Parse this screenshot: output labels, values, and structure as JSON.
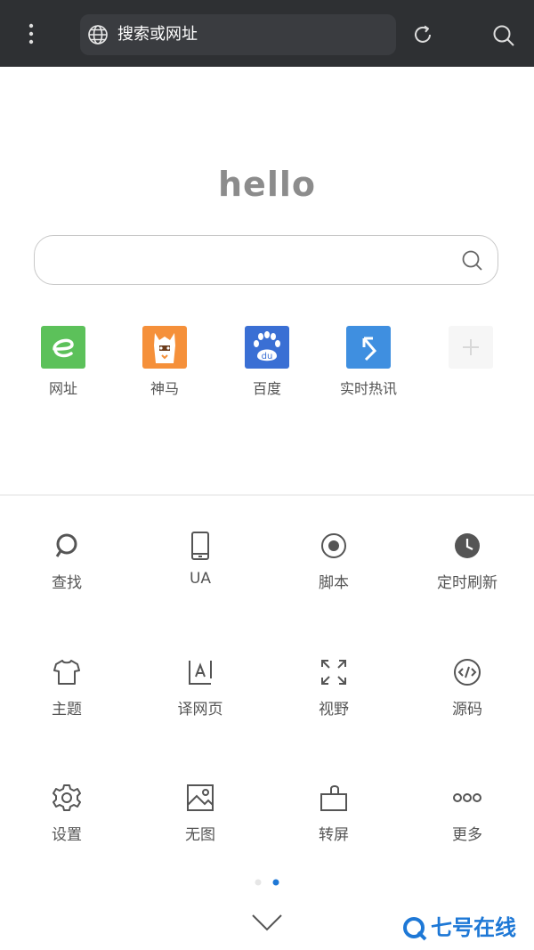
{
  "topbar": {
    "placeholder": "搜索或网址",
    "icons": [
      "menu-dots-icon",
      "globe-icon",
      "refresh-icon",
      "search-icon"
    ],
    "background": "#2e3033"
  },
  "home": {
    "logo_text": "hello",
    "shortcuts": [
      {
        "label": "网址",
        "icon": "e-icon",
        "color": "#5cc15a"
      },
      {
        "label": "神马",
        "icon": "alpaca-icon",
        "color": "#f5903a"
      },
      {
        "label": "百度",
        "icon": "baidu-paw-icon",
        "color": "#3a6fd4"
      },
      {
        "label": "实时热讯",
        "icon": "arrow-icon",
        "color": "#3f8fe0"
      },
      {
        "label": "",
        "icon": "plus-icon",
        "color": "#f6f6f6"
      }
    ]
  },
  "tools": [
    {
      "label": "查找",
      "icon": "find-icon"
    },
    {
      "label": "UA",
      "icon": "phone-icon"
    },
    {
      "label": "脚本",
      "icon": "script-icon"
    },
    {
      "label": "定时刷新",
      "icon": "clock-icon"
    },
    {
      "label": "主题",
      "icon": "tshirt-icon"
    },
    {
      "label": "译网页",
      "icon": "translate-icon"
    },
    {
      "label": "视野",
      "icon": "expand-icon"
    },
    {
      "label": "源码",
      "icon": "code-icon"
    },
    {
      "label": "设置",
      "icon": "gear-icon"
    },
    {
      "label": "无图",
      "icon": "image-icon"
    },
    {
      "label": "转屏",
      "icon": "rotate-screen-icon"
    },
    {
      "label": "更多",
      "icon": "more-icon"
    }
  ],
  "pager": {
    "pages": 2,
    "current": 2,
    "active_color": "#1e78d6"
  },
  "watermark": {
    "text": "七号在线"
  }
}
